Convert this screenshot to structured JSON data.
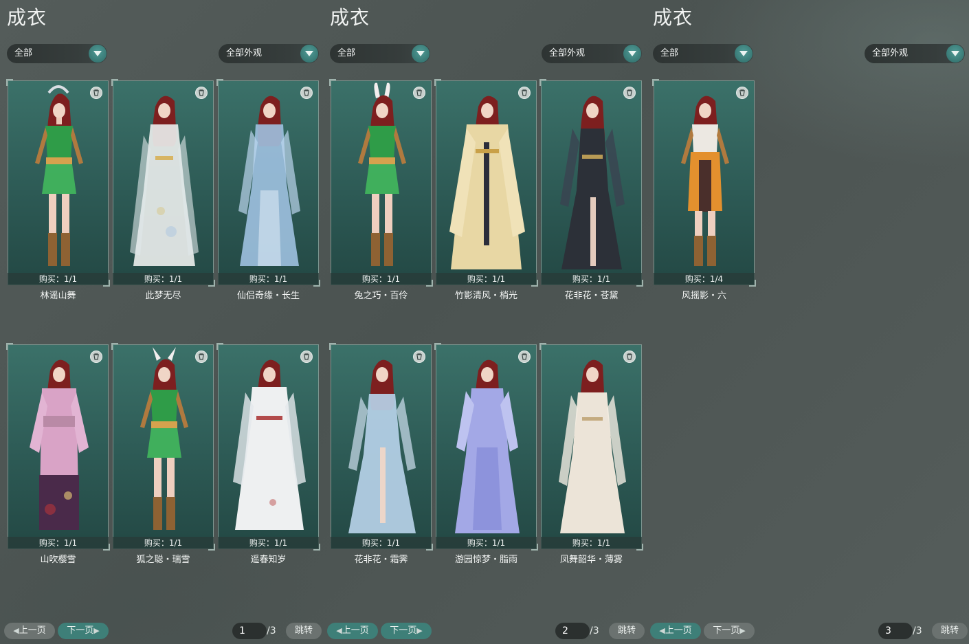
{
  "panels": [
    {
      "title": "成衣",
      "filter_left": "全部",
      "filter_right": "全部外观",
      "prev_label": "上一页",
      "next_label": "下一页",
      "page_current": "1",
      "page_total": "/3",
      "jump_label": "跳转",
      "cards": [
        {
          "name": "林谣山舞",
          "buy": "购买：1/1"
        },
        {
          "name": "此梦无尽",
          "buy": "购买：1/1"
        },
        {
          "name": "仙侣奇缘・长生",
          "buy": "购买：1/1"
        },
        {
          "name": "山吹樱雪",
          "buy": "购买：1/1"
        },
        {
          "name": "狐之聪・瑞雪",
          "buy": "购买：1/1"
        },
        {
          "name": "遥春知岁",
          "buy": "购买：1/1"
        }
      ]
    },
    {
      "title": "成衣",
      "filter_left": "全部",
      "filter_right": "全部外观",
      "prev_label": "上一页",
      "next_label": "下一页",
      "page_current": "2",
      "page_total": "/3",
      "jump_label": "跳转",
      "cards": [
        {
          "name": "兔之巧・百伶",
          "buy": "购买：1/1"
        },
        {
          "name": "竹影清风・梢光",
          "buy": "购买：1/1"
        },
        {
          "name": "花非花・苍黛",
          "buy": "购买：1/1"
        },
        {
          "name": "花非花・霜霁",
          "buy": "购买：1/1"
        },
        {
          "name": "游园惊梦・脂雨",
          "buy": "购买：1/1"
        },
        {
          "name": "凤舞韶华・薄雾",
          "buy": "购买：1/1"
        }
      ]
    },
    {
      "title": "成衣",
      "filter_left": "全部",
      "filter_right": "全部外观",
      "prev_label": "上一页",
      "next_label": "下一页",
      "page_current": "3",
      "page_total": "/3",
      "jump_label": "跳转",
      "cards": [
        {
          "name": "风摇影・六",
          "buy": "购买：1/4"
        }
      ]
    }
  ],
  "icons": {
    "dropdown": "chevron-down-icon",
    "delete": "trash-icon",
    "prev": "chevron-left-icon",
    "next": "chevron-right-icon"
  },
  "colors": {
    "accent": "#3e7f78",
    "card_bg": "#2d5a55",
    "dropdown_bg": "#2e3433",
    "disabled_button": "#6c7371"
  }
}
